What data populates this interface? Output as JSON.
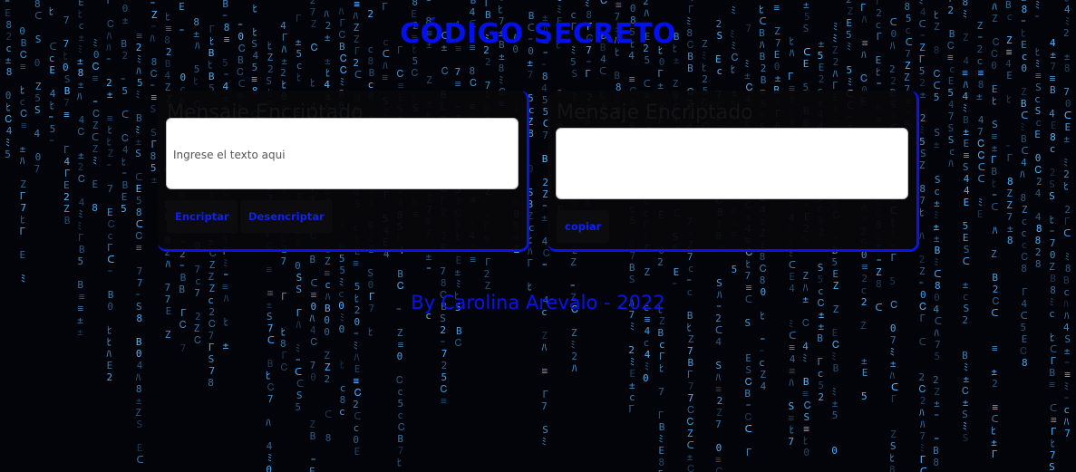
{
  "header": {
    "title": "CÓDIGO SECRETO"
  },
  "encrypt_panel": {
    "heading": "Mensaje Encriptado",
    "input_placeholder": "Ingrese el texto aqui",
    "input_value": "",
    "encrypt_label": "Encriptar",
    "decrypt_label": "Desencriptar"
  },
  "result_panel": {
    "heading": "Mensaje Encriptado",
    "output_value": "",
    "copy_label": "copiar"
  },
  "footer": {
    "text": "By Carolina Arevalo - 2022"
  },
  "colors": {
    "accent": "#0a14e8",
    "background": "#02040a",
    "matrix_glyph": "#5ab8ff"
  }
}
